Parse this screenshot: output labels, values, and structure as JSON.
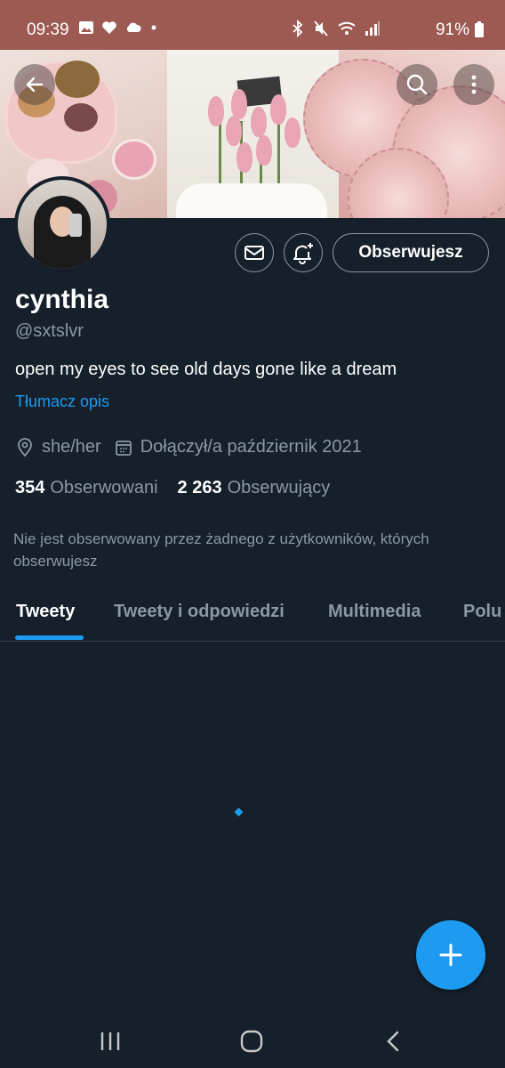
{
  "status_bar": {
    "time": "09:39",
    "battery": "91%",
    "left_icons": [
      "image-icon",
      "heart-icon",
      "cloud-icon",
      "dot-icon"
    ],
    "right_icons": [
      "bluetooth-icon",
      "mute-icon",
      "wifi-icon",
      "signal-icon"
    ]
  },
  "header": {
    "back_icon": "arrow-left-icon",
    "search_icon": "search-icon",
    "more_icon": "more-vertical-icon"
  },
  "profile": {
    "name": "cynthia",
    "handle": "@sxtslvr",
    "bio": "open my eyes to see old days gone like a dream",
    "translate_label": "Tłumacz opis",
    "pronouns": "she/her",
    "joined": "Dołączył/a październik 2021",
    "following_count": "354",
    "following_label": "Obserwowani",
    "followers_count": "2 263",
    "followers_label": "Obserwujący",
    "notice": "Nie jest obserwowany przez żadnego z użytkowników, których obserwujesz"
  },
  "actions": {
    "follow_label": "Obserwujesz",
    "message_icon": "mail-icon",
    "notify_icon": "bell-plus-icon"
  },
  "tabs": [
    {
      "label": "Tweety",
      "active": true
    },
    {
      "label": "Tweety i odpowiedzi",
      "active": false
    },
    {
      "label": "Multimedia",
      "active": false
    },
    {
      "label": "Polu",
      "active": false
    }
  ],
  "fab": {
    "icon": "plus-icon"
  },
  "colors": {
    "background": "#15202b",
    "accent": "#1d9bf0",
    "status_bar": "#9c5a52",
    "secondary_text": "#8b98a5"
  },
  "nav_bar": [
    "recent-apps-icon",
    "home-icon",
    "back-icon"
  ]
}
